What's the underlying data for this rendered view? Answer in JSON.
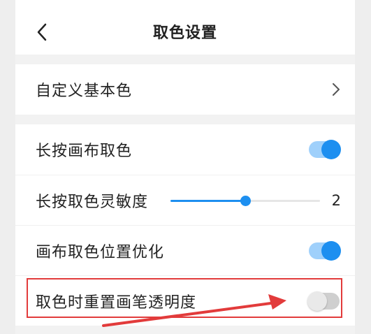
{
  "header": {
    "title": "取色设置"
  },
  "settings": {
    "custom_base_color": {
      "label": "自定义基本色"
    },
    "long_press_pick": {
      "label": "长按画布取色",
      "enabled": true
    },
    "sensitivity": {
      "label": "长按取色灵敏度",
      "value": "2",
      "level_fraction": 0.5
    },
    "position_optimization": {
      "label": "画布取色位置优化",
      "enabled": true
    },
    "reset_opacity": {
      "label": "取色时重置画笔透明度",
      "enabled": false
    }
  },
  "colors": {
    "accent": "#1d8ff0",
    "annotation": "#e23b3b"
  }
}
